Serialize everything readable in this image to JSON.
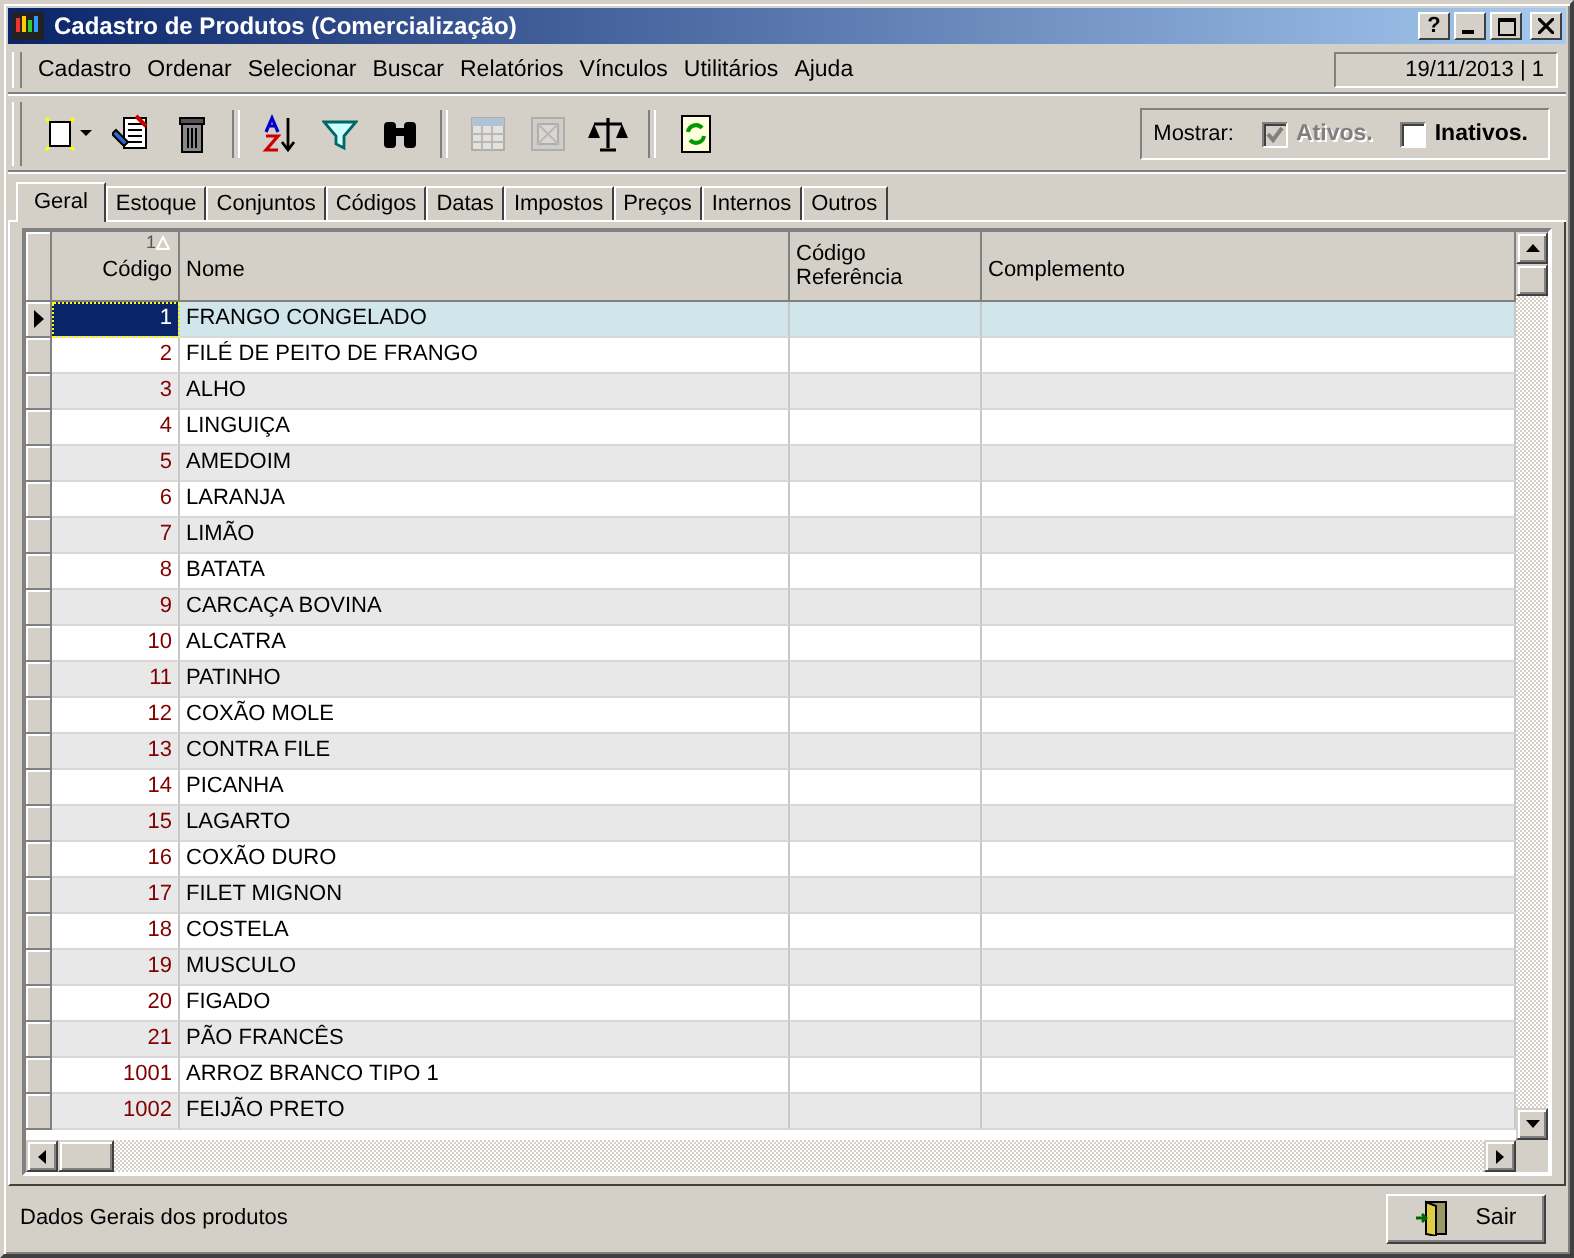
{
  "window": {
    "title": "Cadastro de Produtos (Comercialização)",
    "buttons": [
      "?"
    ]
  },
  "menu": [
    "Cadastro",
    "Ordenar",
    "Selecionar",
    "Buscar",
    "Relatórios",
    "Vínculos",
    "Utilitários",
    "Ajuda"
  ],
  "date_panel": "19/11/2013 | 1",
  "toolbar": [
    [
      {
        "kind": "new",
        "disabled": false
      },
      {
        "kind": "dropdown",
        "disabled": false
      },
      {
        "kind": "edit",
        "disabled": false
      },
      {
        "kind": "delete",
        "disabled": false
      }
    ],
    [
      {
        "kind": "sort",
        "disabled": false
      },
      {
        "kind": "filter",
        "disabled": false
      },
      {
        "kind": "find",
        "disabled": false
      }
    ],
    [
      {
        "kind": "grid",
        "disabled": true
      },
      {
        "kind": "frame",
        "disabled": true
      },
      {
        "kind": "scales",
        "disabled": false
      }
    ],
    [
      {
        "kind": "refresh",
        "disabled": false
      }
    ]
  ],
  "show_filter": {
    "label": "Mostrar:",
    "options": [
      {
        "label": "Ativos.",
        "checked": true,
        "disabled": true
      },
      {
        "label": "Inativos.",
        "checked": false,
        "disabled": false
      }
    ]
  },
  "tabs": [
    {
      "label": "Geral",
      "selected": true
    },
    {
      "label": "Estoque",
      "selected": false
    },
    {
      "label": "Conjuntos",
      "selected": false
    },
    {
      "label": "Códigos",
      "selected": false
    },
    {
      "label": "Datas",
      "selected": false
    },
    {
      "label": "Impostos",
      "selected": false
    },
    {
      "label": "Preços",
      "selected": false
    },
    {
      "label": "Internos",
      "selected": false
    },
    {
      "label": "Outros",
      "selected": false
    }
  ],
  "table": {
    "columns": [
      "Código",
      "Nome",
      "Código Referência",
      "Complemento"
    ],
    "sort_mark": "1",
    "rows": [
      {
        "code": "1",
        "name": "FRANGO CONGELADO",
        "selected": true
      },
      {
        "code": "2",
        "name": "FILÉ DE PEITO DE FRANGO",
        "selected": false
      },
      {
        "code": "3",
        "name": "ALHO",
        "selected": false
      },
      {
        "code": "4",
        "name": "LINGUIÇA",
        "selected": false
      },
      {
        "code": "5",
        "name": "AMEDOIM",
        "selected": false
      },
      {
        "code": "6",
        "name": "LARANJA",
        "selected": false
      },
      {
        "code": "7",
        "name": "LIMÃO",
        "selected": false
      },
      {
        "code": "8",
        "name": "BATATA",
        "selected": false
      },
      {
        "code": "9",
        "name": "CARCAÇA BOVINA",
        "selected": false
      },
      {
        "code": "10",
        "name": "ALCATRA",
        "selected": false
      },
      {
        "code": "11",
        "name": "PATINHO",
        "selected": false
      },
      {
        "code": "12",
        "name": "COXÃO MOLE",
        "selected": false
      },
      {
        "code": "13",
        "name": "CONTRA FILE",
        "selected": false
      },
      {
        "code": "14",
        "name": "PICANHA",
        "selected": false
      },
      {
        "code": "15",
        "name": "LAGARTO",
        "selected": false
      },
      {
        "code": "16",
        "name": "COXÃO DURO",
        "selected": false
      },
      {
        "code": "17",
        "name": "FILET MIGNON",
        "selected": false
      },
      {
        "code": "18",
        "name": "COSTELA",
        "selected": false
      },
      {
        "code": "19",
        "name": "MUSCULO",
        "selected": false
      },
      {
        "code": "20",
        "name": "FIGADO",
        "selected": false
      },
      {
        "code": "21",
        "name": "PÃO FRANCÊS",
        "selected": false
      },
      {
        "code": "1001",
        "name": "ARROZ BRANCO TIPO 1",
        "selected": false
      },
      {
        "code": "1002",
        "name": "FEIJÃO PRETO",
        "selected": false
      }
    ]
  },
  "status_bar": "Dados Gerais dos produtos",
  "exit_button": "Sair"
}
